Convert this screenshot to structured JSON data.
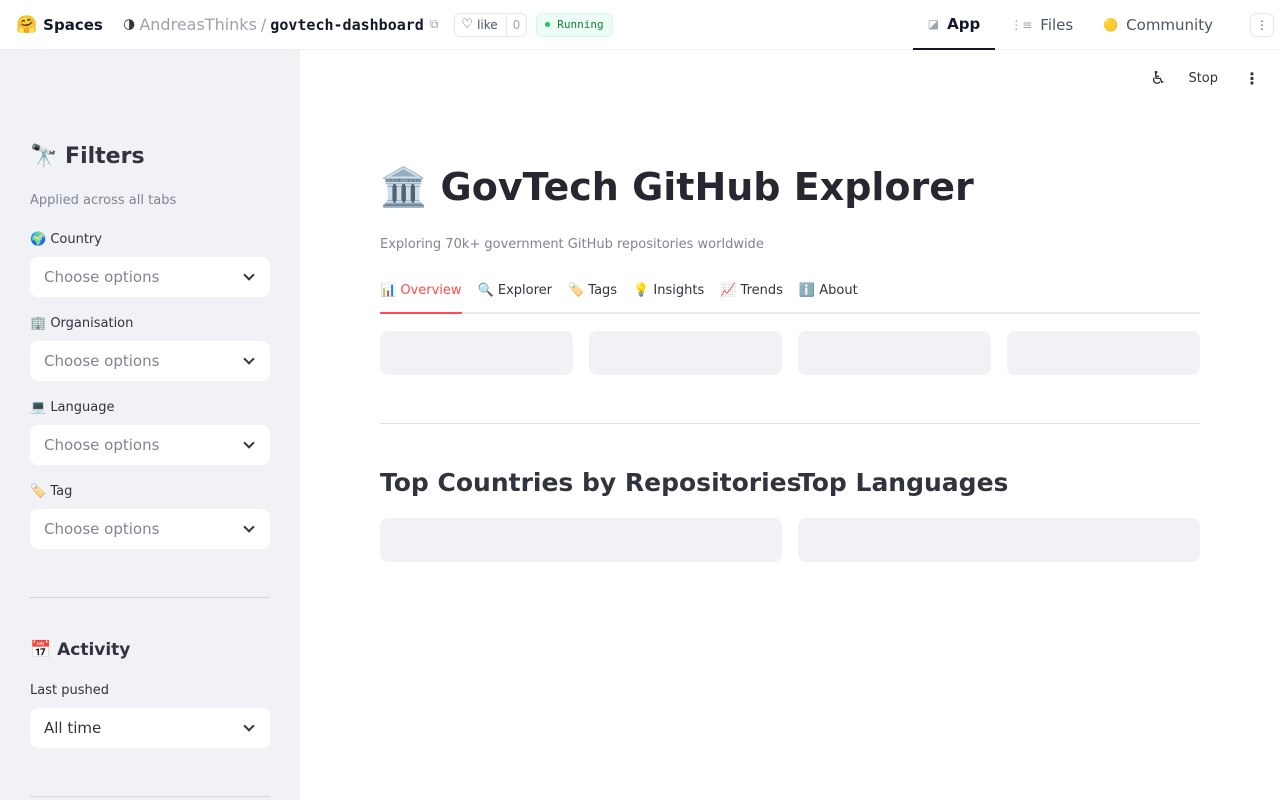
{
  "header": {
    "brand_icon": "🤗",
    "brand_label": "Spaces",
    "owner_icon": "🌗",
    "owner": "AndreasThinks",
    "separator": "/",
    "repo": "govtech-dashboard",
    "copy_icon": "⧉",
    "like_icon": "♡",
    "like_label": "like",
    "like_count": "0",
    "status": "Running",
    "tabs": [
      {
        "icon": "◪",
        "label": "App"
      },
      {
        "icon": "⋮≡",
        "label": "Files"
      },
      {
        "icon": "🟡",
        "label": "Community"
      }
    ],
    "menu_icon": "⋮"
  },
  "sidebar": {
    "filters_heading": "🔭 Filters",
    "filters_caption": "Applied across all tabs",
    "fields": [
      {
        "label": "🌍 Country",
        "placeholder": "Choose options"
      },
      {
        "label": "🏢 Organisation",
        "placeholder": "Choose options"
      },
      {
        "label": "💻 Language",
        "placeholder": "Choose options"
      },
      {
        "label": "🏷️ Tag",
        "placeholder": "Choose options"
      }
    ],
    "activity_heading": "📅 Activity",
    "last_pushed_label": "Last pushed",
    "last_pushed_value": "All time"
  },
  "main": {
    "toolbar": {
      "running_icon": "♿",
      "stop_label": "Stop",
      "menu_icon": "⋮"
    },
    "title": "🏛️ GovTech GitHub Explorer",
    "subtitle": "Exploring 70k+ government GitHub repositories worldwide",
    "tabs": [
      "📊 Overview",
      "🔍 Explorer",
      "🏷️ Tags",
      "💡 Insights",
      "📈 Trends",
      "ℹ️ About"
    ],
    "section_countries": "Top Countries by Repositories",
    "section_languages": "Top Languages"
  },
  "colors": {
    "accent": "#ff4b4b",
    "sidebar_bg": "#f0f2f6",
    "status_green": "#22c55e"
  }
}
